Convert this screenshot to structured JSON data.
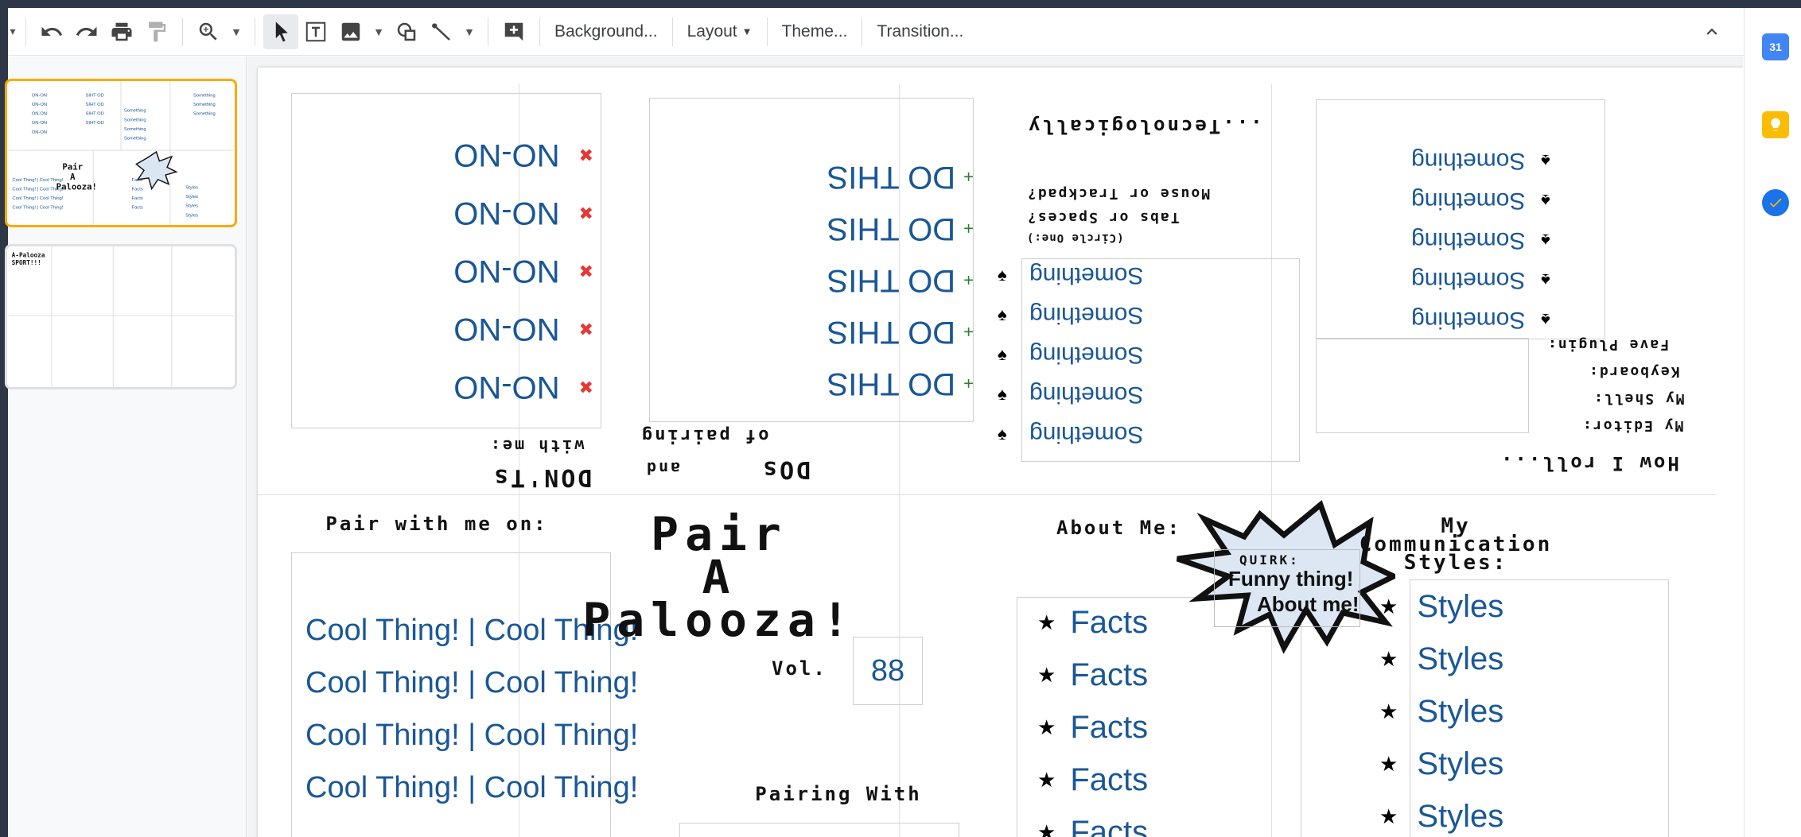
{
  "toolbar": {
    "background_label": "Background...",
    "layout_label": "Layout",
    "theme_label": "Theme...",
    "transition_label": "Transition..."
  },
  "side_panel": {
    "calendar_label": "31"
  },
  "slide": {
    "top": {
      "donts_title": "DON'Ts",
      "donts_subtitle": "with me:",
      "donts_items": [
        "NO-NO",
        "NO-NO",
        "NO-NO",
        "NO-NO",
        "NO-NO"
      ],
      "dos_title": "DOs",
      "and_label": "and",
      "dos_subtitle": "of pairing",
      "dos_items": [
        "DO THIS",
        "DO THIS",
        "DO THIS",
        "DO THIS",
        "DO THIS"
      ],
      "tech_title": "...Tecnologically",
      "tech_q1": "Mouse or Trackpad?",
      "tech_q2": "Tabs or Spaces?",
      "tech_hint": "(Circle One:)",
      "tech_items": [
        "Something",
        "Something",
        "Something",
        "Something",
        "Something"
      ],
      "roll_title": "How I roll...",
      "roll_items": [
        "Something",
        "Something",
        "Something",
        "Something",
        "Something"
      ],
      "roll_labels": [
        "Fave Plugin:",
        "Keyboard:",
        "My Shell:",
        "My Editor:"
      ]
    },
    "bottom": {
      "pair_with_title": "Pair with me on:",
      "cool_things": [
        "Cool Thing! | Cool Thing!",
        "Cool Thing! | Cool Thing!",
        "Cool Thing! | Cool Thing!",
        "Cool Thing! | Cool Thing!"
      ],
      "palooza_line1": "Pair",
      "palooza_line2": "A",
      "palooza_line3": "Palooza!",
      "vol_label": "Vol.",
      "vol_number": "88",
      "pairing_with": "Pairing With",
      "about_title": "About Me:",
      "quirk_label": "QUIRK:",
      "quirk_text1": "Funny thing!",
      "quirk_text2": "About me!",
      "facts": [
        "Facts",
        "Facts",
        "Facts",
        "Facts",
        "Facts"
      ],
      "comm_title_1": "My",
      "comm_title_2": "Communication",
      "comm_title_3": "Styles:",
      "styles": [
        "Styles",
        "Styles",
        "Styles",
        "Styles",
        "Styles"
      ]
    }
  },
  "thumbnails": {
    "thumb1_palooza": "Pair A Palooza!",
    "thumb2_title": "A-Palooza SPORT!!!"
  },
  "colors": {
    "accent_selected": "#f9ab00",
    "text_blue": "#1a5796",
    "dark_frame": "#2d3748"
  }
}
